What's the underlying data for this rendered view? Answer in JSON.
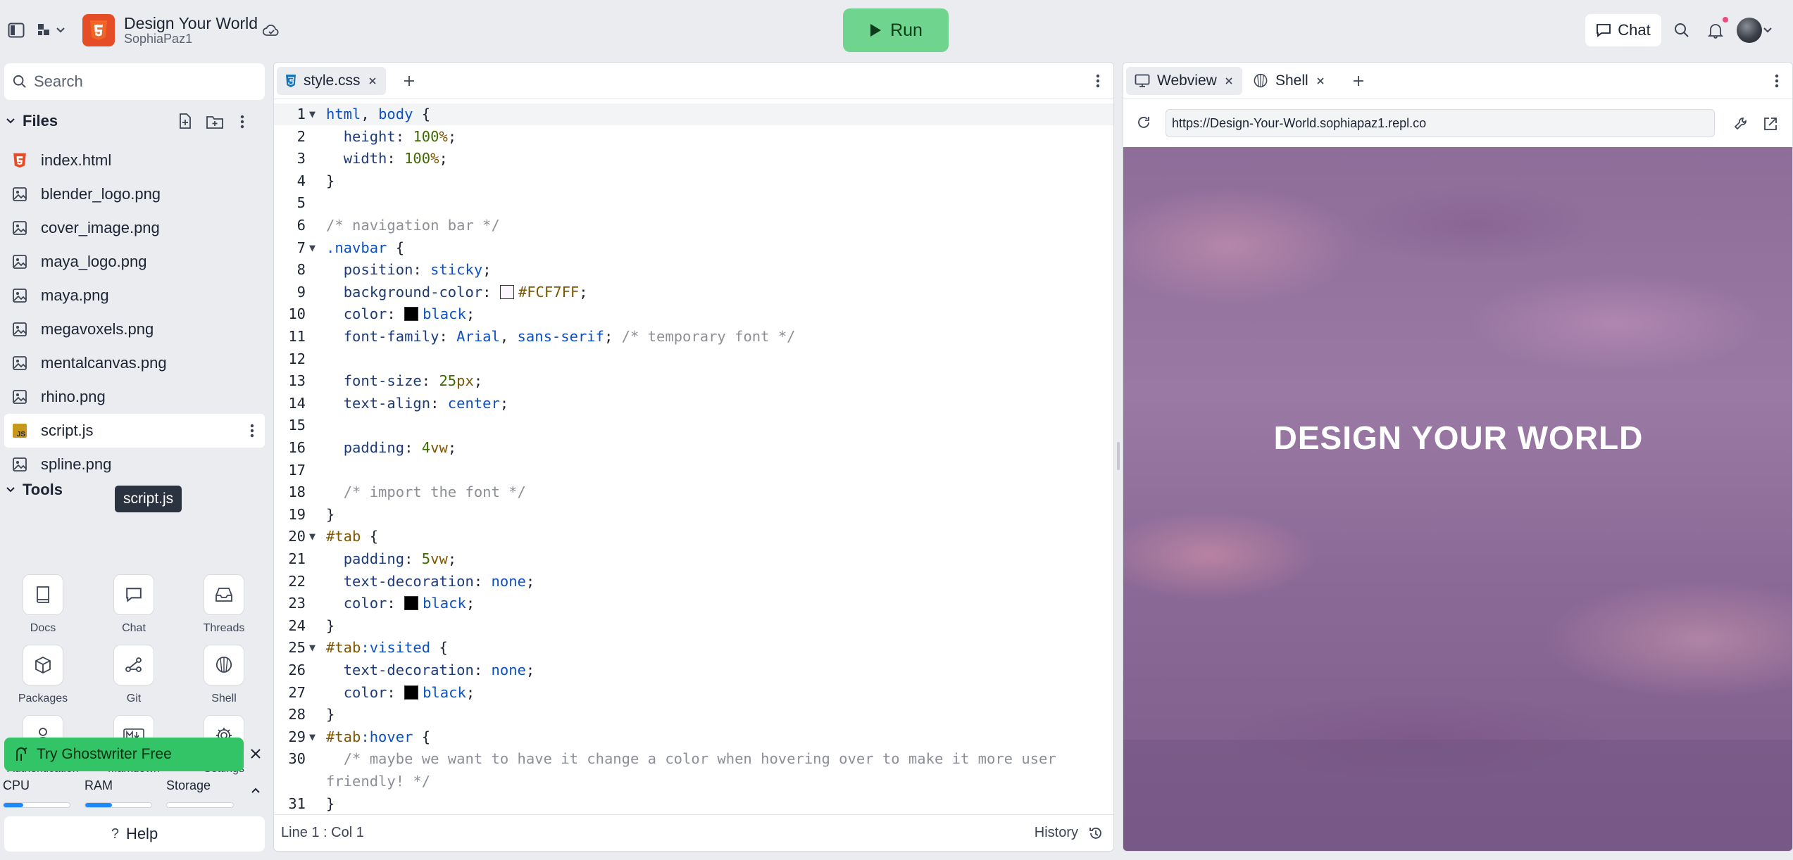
{
  "app": {
    "title": "Design Your World",
    "user": "SophiaPaz1"
  },
  "topbar": {
    "run_label": "Run",
    "chat_label": "Chat"
  },
  "sidebar": {
    "search_placeholder": "Search",
    "files_label": "Files",
    "files": [
      {
        "name": "index.html",
        "icon": "html5-icon"
      },
      {
        "name": "blender_logo.png",
        "icon": "image-icon"
      },
      {
        "name": "cover_image.png",
        "icon": "image-icon"
      },
      {
        "name": "maya_logo.png",
        "icon": "image-icon"
      },
      {
        "name": "maya.png",
        "icon": "image-icon"
      },
      {
        "name": "megavoxels.png",
        "icon": "image-icon"
      },
      {
        "name": "mentalcanvas.png",
        "icon": "image-icon"
      },
      {
        "name": "rhino.png",
        "icon": "image-icon"
      },
      {
        "name": "script.js",
        "icon": "js-icon"
      },
      {
        "name": "spline.png",
        "icon": "image-icon"
      }
    ],
    "tooltip": "script.js",
    "tools_label": "Tools",
    "tools": [
      {
        "label": "Docs",
        "icon": "book-icon"
      },
      {
        "label": "Chat",
        "icon": "chat-icon"
      },
      {
        "label": "Threads",
        "icon": "inbox-icon"
      },
      {
        "label": "Packages",
        "icon": "package-icon"
      },
      {
        "label": "Git",
        "icon": "git-icon"
      },
      {
        "label": "Shell",
        "icon": "shell-icon"
      },
      {
        "label": "Authentication",
        "icon": "user-icon"
      },
      {
        "label": "Markdown",
        "icon": "markdown-icon"
      },
      {
        "label": "Settings",
        "icon": "gear-icon"
      }
    ],
    "ghostwriter_label": "Try Ghostwriter Free",
    "usage": {
      "cpu_label": "CPU",
      "ram_label": "RAM",
      "storage_label": "Storage",
      "cpu": 0.3,
      "ram": 0.4,
      "storage": 0.0
    },
    "help_label": "Help"
  },
  "editor": {
    "tab_label": "style.css",
    "status_position": "Line 1 : Col 1",
    "history_label": "History",
    "lines": [
      {
        "n": "1",
        "fold": true,
        "tokens": [
          [
            "kw",
            "html"
          ],
          [
            "st",
            ", "
          ],
          [
            "kw",
            "body"
          ],
          [
            "st",
            " {"
          ]
        ]
      },
      {
        "n": "2",
        "tokens": [
          [
            "st",
            "  "
          ],
          [
            "pr",
            "height"
          ],
          [
            "st",
            ": "
          ],
          [
            "nm",
            "100"
          ],
          [
            "sy",
            "%"
          ],
          [
            "st",
            ";"
          ]
        ]
      },
      {
        "n": "3",
        "tokens": [
          [
            "st",
            "  "
          ],
          [
            "pr",
            "width"
          ],
          [
            "st",
            ": "
          ],
          [
            "nm",
            "100"
          ],
          [
            "sy",
            "%"
          ],
          [
            "st",
            ";"
          ]
        ]
      },
      {
        "n": "4",
        "tokens": [
          [
            "st",
            "}"
          ]
        ]
      },
      {
        "n": "5",
        "tokens": []
      },
      {
        "n": "6",
        "tokens": [
          [
            "cm",
            "/* navigation bar */"
          ]
        ]
      },
      {
        "n": "7",
        "fold": true,
        "tokens": [
          [
            "kw",
            ".navbar"
          ],
          [
            "st",
            " {"
          ]
        ]
      },
      {
        "n": "8",
        "tokens": [
          [
            "st",
            "  "
          ],
          [
            "pr",
            "position"
          ],
          [
            "st",
            ": "
          ],
          [
            "fn",
            "sticky"
          ],
          [
            "st",
            ";"
          ]
        ]
      },
      {
        "n": "9",
        "tokens": [
          [
            "st",
            "  "
          ],
          [
            "pr",
            "background-color"
          ],
          [
            "st",
            ": "
          ],
          [
            "swatch",
            "#FCF7FF"
          ],
          [
            "sy",
            "#FCF7FF"
          ],
          [
            "st",
            ";"
          ]
        ]
      },
      {
        "n": "10",
        "tokens": [
          [
            "st",
            "  "
          ],
          [
            "pr",
            "color"
          ],
          [
            "st",
            ": "
          ],
          [
            "swatch",
            "#000000"
          ],
          [
            "fn",
            "black"
          ],
          [
            "st",
            ";"
          ]
        ]
      },
      {
        "n": "11",
        "tokens": [
          [
            "st",
            "  "
          ],
          [
            "pr",
            "font-family"
          ],
          [
            "st",
            ": "
          ],
          [
            "fn",
            "Arial"
          ],
          [
            "st",
            ", "
          ],
          [
            "fn",
            "sans-serif"
          ],
          [
            "st",
            "; "
          ],
          [
            "cm",
            "/* temporary font */"
          ]
        ]
      },
      {
        "n": "12",
        "tokens": []
      },
      {
        "n": "13",
        "tokens": [
          [
            "st",
            "  "
          ],
          [
            "pr",
            "font-size"
          ],
          [
            "st",
            ": "
          ],
          [
            "nm",
            "25"
          ],
          [
            "sy",
            "px"
          ],
          [
            "st",
            ";"
          ]
        ]
      },
      {
        "n": "14",
        "tokens": [
          [
            "st",
            "  "
          ],
          [
            "pr",
            "text-align"
          ],
          [
            "st",
            ": "
          ],
          [
            "fn",
            "center"
          ],
          [
            "st",
            ";"
          ]
        ]
      },
      {
        "n": "15",
        "tokens": []
      },
      {
        "n": "16",
        "tokens": [
          [
            "st",
            "  "
          ],
          [
            "pr",
            "padding"
          ],
          [
            "st",
            ": "
          ],
          [
            "nm",
            "4"
          ],
          [
            "sy",
            "vw"
          ],
          [
            "st",
            ";"
          ]
        ]
      },
      {
        "n": "17",
        "tokens": []
      },
      {
        "n": "18",
        "tokens": [
          [
            "st",
            "  "
          ],
          [
            "cm",
            "/* import the font */"
          ]
        ]
      },
      {
        "n": "19",
        "tokens": [
          [
            "st",
            "}"
          ]
        ]
      },
      {
        "n": "20",
        "fold": true,
        "tokens": [
          [
            "sy",
            "#tab"
          ],
          [
            "st",
            " {"
          ]
        ]
      },
      {
        "n": "21",
        "tokens": [
          [
            "st",
            "  "
          ],
          [
            "pr",
            "padding"
          ],
          [
            "st",
            ": "
          ],
          [
            "nm",
            "5"
          ],
          [
            "sy",
            "vw"
          ],
          [
            "st",
            ";"
          ]
        ]
      },
      {
        "n": "22",
        "tokens": [
          [
            "st",
            "  "
          ],
          [
            "pr",
            "text-decoration"
          ],
          [
            "st",
            ": "
          ],
          [
            "fn",
            "none"
          ],
          [
            "st",
            ";"
          ]
        ]
      },
      {
        "n": "23",
        "tokens": [
          [
            "st",
            "  "
          ],
          [
            "pr",
            "color"
          ],
          [
            "st",
            ": "
          ],
          [
            "swatch",
            "#000000"
          ],
          [
            "fn",
            "black"
          ],
          [
            "st",
            ";"
          ]
        ]
      },
      {
        "n": "24",
        "tokens": [
          [
            "st",
            "}"
          ]
        ]
      },
      {
        "n": "25",
        "fold": true,
        "tokens": [
          [
            "sy",
            "#tab"
          ],
          [
            "kw",
            ":visited"
          ],
          [
            "st",
            " {"
          ]
        ]
      },
      {
        "n": "26",
        "tokens": [
          [
            "st",
            "  "
          ],
          [
            "pr",
            "text-decoration"
          ],
          [
            "st",
            ": "
          ],
          [
            "fn",
            "none"
          ],
          [
            "st",
            ";"
          ]
        ]
      },
      {
        "n": "27",
        "tokens": [
          [
            "st",
            "  "
          ],
          [
            "pr",
            "color"
          ],
          [
            "st",
            ": "
          ],
          [
            "swatch",
            "#000000"
          ],
          [
            "fn",
            "black"
          ],
          [
            "st",
            ";"
          ]
        ]
      },
      {
        "n": "28",
        "tokens": [
          [
            "st",
            "}"
          ]
        ]
      },
      {
        "n": "29",
        "fold": true,
        "tokens": [
          [
            "sy",
            "#tab"
          ],
          [
            "kw",
            ":hover"
          ],
          [
            "st",
            " {"
          ]
        ]
      },
      {
        "n": "30",
        "tokens": [
          [
            "st",
            "  "
          ],
          [
            "cm",
            "/* maybe we want to have it change a color when hovering over to make it more user"
          ]
        ]
      },
      {
        "n": "",
        "tokens": [
          [
            "cm",
            "friendly! */"
          ]
        ]
      },
      {
        "n": "31",
        "tokens": [
          [
            "st",
            "}"
          ]
        ]
      }
    ]
  },
  "preview": {
    "webview_tab": "Webview",
    "shell_tab": "Shell",
    "url": "https://Design-Your-World.sophiapaz1.repl.co",
    "hero_text": "DESIGN YOUR WORLD"
  }
}
